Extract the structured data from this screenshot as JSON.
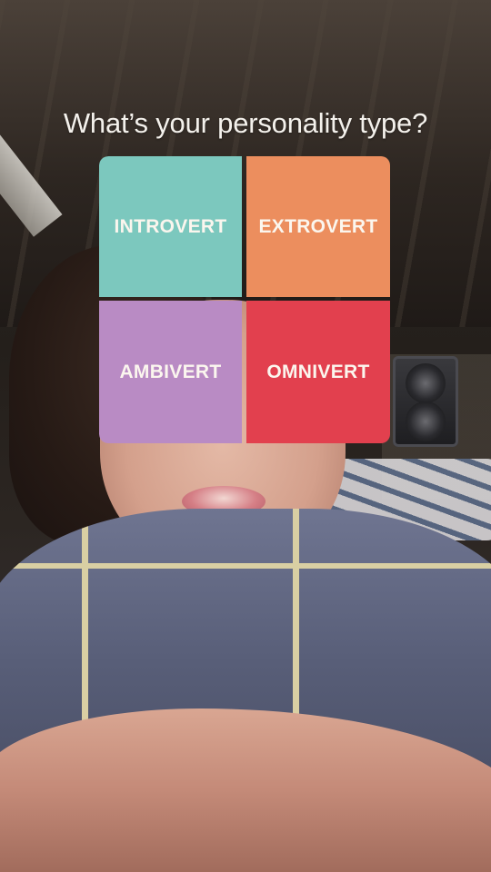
{
  "question": "What’s your personality type?",
  "options": [
    {
      "label": "INTROVERT",
      "color": "#7cc8be"
    },
    {
      "label": "EXTROVERT",
      "color": "#ec8e5e"
    },
    {
      "label": "AMBIVERT",
      "color": "#b98bc4"
    },
    {
      "label": "OMNIVERT",
      "color": "#e2404e"
    }
  ]
}
